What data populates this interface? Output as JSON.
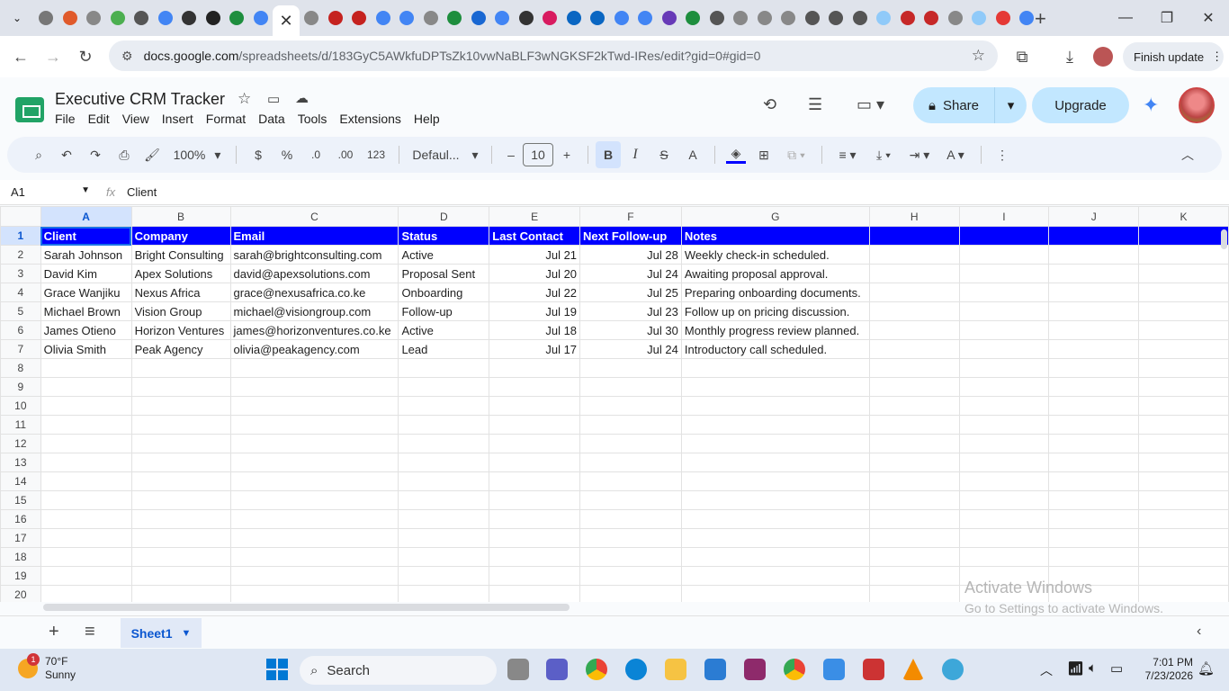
{
  "browser": {
    "active_tab_close": "✕",
    "new_tab": "+",
    "url_host": "docs.google.com",
    "url_path": "/spreadsheets/d/183GyC5AWkfuDPTsZk10vwNaBLF3wNGKSF2kTwd-IRes/edit?gid=0#gid=0",
    "finish_update": "Finish update",
    "favicon_colors": [
      "#777777",
      "#e05a2b",
      "#888888",
      "#4caf50",
      "#555555",
      "#4285f4",
      "#333333",
      "#222222",
      "#1e8e3e",
      "#4285f4",
      "#888888",
      "#c5221f",
      "#c5221f",
      "#4285f4",
      "#4285f4",
      "#888888",
      "#1e8e3e",
      "#1967d2",
      "#4285f4",
      "#333333",
      "#d81b60",
      "#0a66c2",
      "#0a66c2",
      "#4285f4",
      "#4285f4",
      "#673ab7",
      "#1e8e3e",
      "#555555",
      "#888888",
      "#888888",
      "#888888",
      "#555555",
      "#555555",
      "#555555",
      "#90caf9",
      "#c62828",
      "#c62828",
      "#888888",
      "#90caf9",
      "#e53935",
      "#4285f4"
    ]
  },
  "sheets": {
    "title": "Executive CRM Tracker",
    "menu": [
      "File",
      "Edit",
      "View",
      "Insert",
      "Format",
      "Data",
      "Tools",
      "Extensions",
      "Help"
    ],
    "share_label": "Share",
    "upgrade_label": "Upgrade",
    "toolbar": {
      "zoom": "100%",
      "currency": "$",
      "percent": "%",
      "dec_decrease": ".0",
      "dec_increase": ".00",
      "number_format": "123",
      "font": "Defaul...",
      "font_size": "10",
      "bold": "B",
      "italic": "I",
      "text_color": "A"
    },
    "name_box": "A1",
    "formula_label": "fx",
    "formula_value": "Client",
    "column_headers": [
      "A",
      "B",
      "C",
      "D",
      "E",
      "F",
      "G",
      "H",
      "I",
      "J",
      "K"
    ],
    "header_row": [
      "Client",
      "Company",
      "Email",
      "Status",
      "Last Contact",
      "Next Follow-up",
      "Notes"
    ],
    "rows": [
      [
        "Sarah Johnson",
        "Bright Consulting",
        "sarah@brightconsulting.com",
        "Active",
        "Jul 21",
        "Jul 28",
        "Weekly check-in scheduled."
      ],
      [
        "David Kim",
        "Apex Solutions",
        "david@apexsolutions.com",
        "Proposal Sent",
        "Jul 20",
        "Jul 24",
        "Awaiting proposal approval."
      ],
      [
        "Grace Wanjiku",
        "Nexus Africa",
        "grace@nexusafrica.co.ke",
        "Onboarding",
        "Jul 22",
        "Jul 25",
        "Preparing onboarding documents."
      ],
      [
        "Michael Brown",
        "Vision Group",
        "michael@visiongroup.com",
        "Follow-up",
        "Jul 19",
        "Jul 23",
        "Follow up on pricing discussion."
      ],
      [
        "James Otieno",
        "Horizon Ventures",
        "james@horizonventures.co.ke",
        "Active",
        "Jul 18",
        "Jul 30",
        "Monthly progress review planned."
      ],
      [
        "Olivia Smith",
        "Peak Agency",
        "olivia@peakagency.com",
        "Lead",
        "Jul 17",
        "Jul 24",
        "Introductory call scheduled."
      ]
    ],
    "row_numbers": [
      "1",
      "2",
      "3",
      "4",
      "5",
      "6",
      "7",
      "8",
      "9",
      "10",
      "11",
      "12",
      "13",
      "14",
      "15",
      "16",
      "17",
      "18",
      "19",
      "20"
    ],
    "sheet_tab": "Sheet1",
    "add_sheet": "+",
    "all_sheets": "≡",
    "watermark_title": "Activate Windows",
    "watermark_sub": "Go to Settings to activate Windows.",
    "header_fill_color": "#0000ff"
  },
  "taskbar": {
    "weather_temp": "70°F",
    "weather_desc": "Sunny",
    "weather_badge": "1",
    "search_label": "Search",
    "time": "7:01 PM",
    "date": "7/23/2026"
  }
}
